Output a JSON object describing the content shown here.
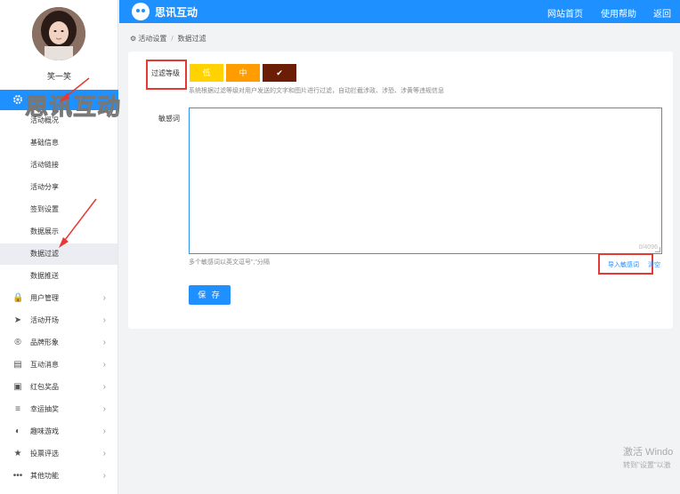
{
  "user": {
    "name": "笑一笑"
  },
  "watermark": "思讯互动",
  "sidebar": {
    "sub_items": [
      "活动概况",
      "基础信息",
      "活动链接",
      "活动分享",
      "签到设置",
      "数据展示",
      "数据过滤",
      "数据推送"
    ],
    "active_index": 6,
    "nav_items": [
      {
        "label": "用户管理",
        "icon": "lock-icon"
      },
      {
        "label": "活动开场",
        "icon": "paper-plane-icon"
      },
      {
        "label": "品牌形象",
        "icon": "registered-icon"
      },
      {
        "label": "互动消息",
        "icon": "chat-icon"
      },
      {
        "label": "红包奖品",
        "icon": "gift-icon"
      },
      {
        "label": "幸运抽奖",
        "icon": "sliders-icon"
      },
      {
        "label": "趣味游戏",
        "icon": "gamepad-icon"
      },
      {
        "label": "投票评选",
        "icon": "star-icon"
      },
      {
        "label": "其他功能",
        "icon": "more-icon"
      }
    ]
  },
  "header": {
    "brand": "思讯互动",
    "links": [
      "网站首页",
      "使用帮助",
      "返回"
    ]
  },
  "breadcrumb": {
    "section": "活动设置",
    "page": "数据过滤"
  },
  "form": {
    "level_label": "过滤等级",
    "levels": [
      {
        "label": "低",
        "color": "#ffd200"
      },
      {
        "label": "中",
        "color": "#ff9c00"
      },
      {
        "label": "✔",
        "color": "#6b1d06"
      }
    ],
    "level_hint": "系统根据过滤等级对用户发送的文字和图片进行过滤，自动拦截涉政、涉恐、涉黄等违规信息",
    "words_label": "敏感词",
    "words_value": "",
    "counter": "0/4096",
    "separator_hint": "多个敏感词以英文逗号\",\"分隔",
    "import_label": "导入敏感词",
    "clear_label": "清空",
    "save_label": "保 存"
  },
  "os_overlay": {
    "line1": "激活 Windo",
    "line2": "转到\"设置\"以激"
  },
  "colors": {
    "primary": "#1e90ff",
    "annotation": "#e53935"
  }
}
